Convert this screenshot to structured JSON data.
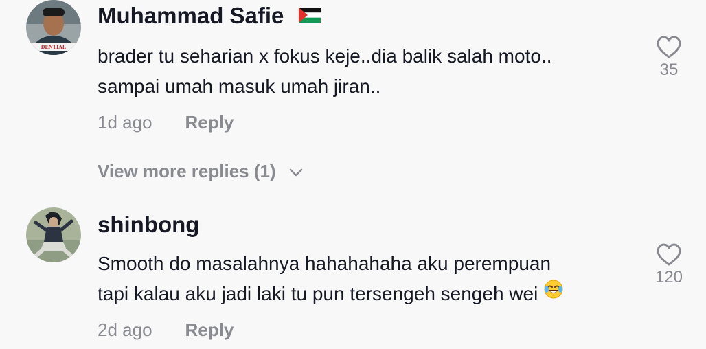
{
  "comments": [
    {
      "username": "Muhammad Safie",
      "lines": [
        "brader tu seharian x fokus keje..dia balik salah moto..",
        "sampai umah masuk umah jiran.."
      ],
      "time": "1d ago",
      "reply_label": "Reply",
      "likes": "35",
      "avatar_text": "DENTIAL",
      "flag_icon": "palestine-flag-icon"
    },
    {
      "username": "shinbong",
      "lines": [
        "Smooth do masalahnya hahahahaha aku perempuan",
        "tapi kalau aku jadi laki tu pun tersengeh sengeh wei"
      ],
      "time": "2d ago",
      "reply_label": "Reply",
      "likes": "120",
      "emoji_icon": "face-with-tears-of-joy-icon"
    }
  ],
  "view_more": "View more replies (1)",
  "colors": {
    "background": "#f8f8f8",
    "text": "#161823",
    "muted": "#8a8b91"
  }
}
